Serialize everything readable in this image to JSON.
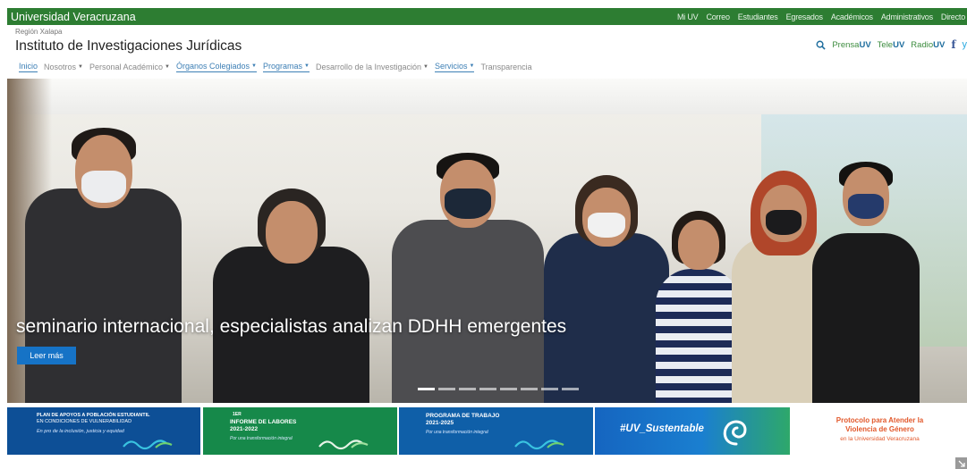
{
  "topbar": {
    "brand": "Universidad Veracruzana",
    "links": [
      "Mi UV",
      "Correo",
      "Estudiantes",
      "Egresados",
      "Académicos",
      "Administrativos",
      "Directo"
    ]
  },
  "header": {
    "region": "Región Xalapa",
    "title": "Instituto de Investigaciones Jurídicas"
  },
  "social": {
    "prensa_a": "Prensa",
    "prensa_b": "UV",
    "tele_a": "Tele",
    "tele_b": "UV",
    "radio_a": "Radio",
    "radio_b": "UV",
    "facebook": "f",
    "twitter": "y"
  },
  "nav": [
    {
      "label": "Inicio",
      "caret": false,
      "active": true
    },
    {
      "label": "Nosotros",
      "caret": true,
      "active": false
    },
    {
      "label": "Personal Académico",
      "caret": true,
      "active": false
    },
    {
      "label": "Órganos Colegiados",
      "caret": true,
      "active": true
    },
    {
      "label": "Programas",
      "caret": true,
      "active": true
    },
    {
      "label": "Desarrollo de la Investigación",
      "caret": true,
      "active": false
    },
    {
      "label": "Servicios",
      "caret": true,
      "active": true
    },
    {
      "label": "Transparencia",
      "caret": false,
      "active": false
    }
  ],
  "hero": {
    "caption": "seminario internacional, especialistas analizan DDHH emergentes",
    "button": "Leer más",
    "slides_total": 8,
    "slide_active": 1
  },
  "banners": {
    "b1_title_bold": "PLAN DE APOYOS A POBLACIÓN ESTUDIANTIL",
    "b1_title_sub": "EN CONDICIONES DE VULNERABILIDAD",
    "b1_tagline": "En pro de la inclusión, justicia y equidad",
    "b2_sup": "1ER",
    "b2_title": "INFORME DE LABORES",
    "b2_years": "2021-2022",
    "b2_tagline": "Por una transformación integral",
    "b3_title": "PROGRAMA DE TRABAJO",
    "b3_years": "2021-2025",
    "b3_tagline": "Por una transformación integral",
    "b4_tag": "#UV_Sustentable",
    "b5_line1": "Protocolo para Atender la",
    "b5_line2": "Violencia de Género",
    "b5_line3": "en la Universidad Veracruzana"
  },
  "colors": {
    "uv_green": "#2d7d32",
    "nav_active": "#3d7fb5",
    "button_blue": "#1673c6",
    "protocol_orange": "#e2582b"
  }
}
